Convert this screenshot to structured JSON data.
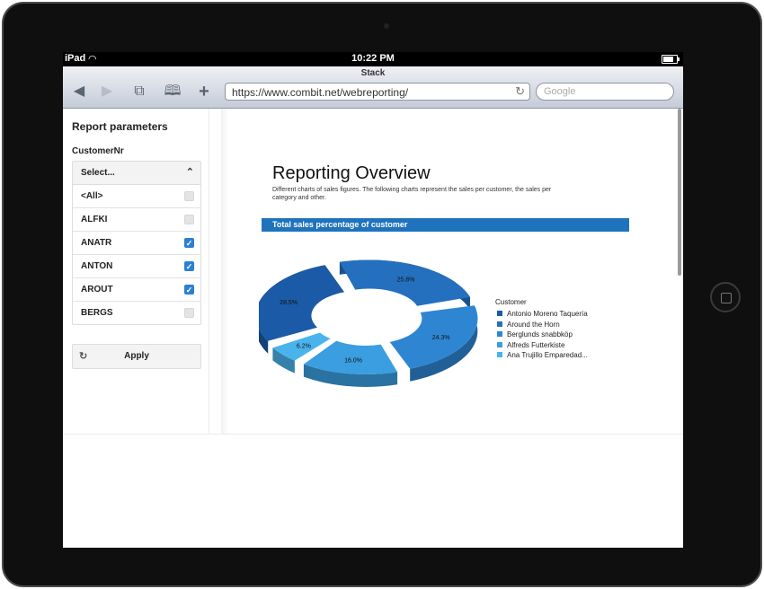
{
  "statusbar": {
    "carrier": "iPad",
    "wifi_icon": "wifi-icon",
    "time": "10:22 PM",
    "battery_level": 0.9
  },
  "browser": {
    "page_title": "Stack",
    "url": "https://www.combit.net/webreporting/",
    "search_placeholder": "Google",
    "icons": {
      "back": "back-arrow-icon",
      "forward": "forward-arrow-icon",
      "tabs": "tabs-icon",
      "bookmarks": "bookmarks-icon",
      "add": "add-icon",
      "reload": "reload-icon"
    }
  },
  "sidebar": {
    "title": "Report parameters",
    "field_label": "CustomerNr",
    "dropdown_header": "Select...",
    "options": [
      {
        "label": "<All>",
        "checked": false
      },
      {
        "label": "ALFKI",
        "checked": false
      },
      {
        "label": "ANATR",
        "checked": true
      },
      {
        "label": "ANTON",
        "checked": true
      },
      {
        "label": "AROUT",
        "checked": true
      },
      {
        "label": "BERGS",
        "checked": false
      }
    ],
    "apply_label": "Apply"
  },
  "report": {
    "title": "Reporting Overview",
    "description": "Different charts of sales figures. The following charts represent the sales per customer, the sales per category and other.",
    "section_title": "Total sales percentage of customer"
  },
  "chart_data": {
    "type": "pie",
    "style": "3d-donut",
    "legend_title": "Customer",
    "legend_position": "right",
    "series": [
      {
        "name": "Antonio Moreno Taquería",
        "value": 28.5,
        "label": "28.5%",
        "color": "#1b5aa6"
      },
      {
        "name": "Around the Horn",
        "value": 25.8,
        "label": "25.8%",
        "color": "#2470bf"
      },
      {
        "name": "Berglunds snabbköp",
        "value": 24.3,
        "label": "24.3%",
        "color": "#2e86d2"
      },
      {
        "name": "Alfreds Futterkiste",
        "value": 16.0,
        "label": "16.0%",
        "color": "#3a9ee0"
      },
      {
        "name": "Ana Trujillo Emparedad...",
        "value": 6.2,
        "label": "6.2%",
        "color": "#49b3ec"
      }
    ]
  }
}
